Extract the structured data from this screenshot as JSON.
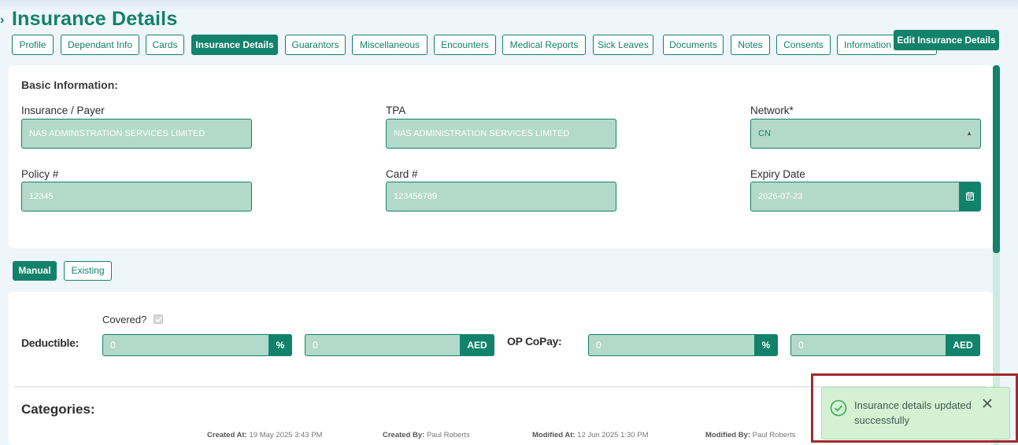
{
  "page": {
    "title": "Insurance Details"
  },
  "tabs": [
    {
      "label": "Profile"
    },
    {
      "label": "Dependant Info"
    },
    {
      "label": "Cards"
    },
    {
      "label": "Insurance Details",
      "active": true
    },
    {
      "label": "Guarantors"
    },
    {
      "label": "Miscellaneous"
    },
    {
      "label": "Encounters"
    },
    {
      "label": "Medical Reports"
    },
    {
      "label": "Sick Leaves"
    },
    {
      "label": "Documents"
    },
    {
      "label": "Notes"
    },
    {
      "label": "Consents"
    },
    {
      "label": "Information"
    }
  ],
  "actions": {
    "edit_label": "Edit Insurance Details"
  },
  "basic_info": {
    "title": "Basic Information:",
    "insurance_label": "Insurance / Payer",
    "insurance_value": "NAS ADMINISTRATION SERVICES LIMITED",
    "tpa_label": "TPA",
    "tpa_value": "NAS ADMINISTRATION SERVICES LIMITED",
    "network_label": "Network*",
    "network_value": "CN",
    "policy_label": "Policy #",
    "policy_value": "12345",
    "card_label": "Card #",
    "card_value": "123456789",
    "expiry_label": "Expiry Date",
    "expiry_value": "2026-07-23"
  },
  "mode": {
    "manual_label": "Manual",
    "existing_label": "Existing"
  },
  "coverage": {
    "covered_label": "Covered?",
    "covered_checked": true,
    "deductible_label": "Deductible:",
    "deductible_percent": "0",
    "deductible_amount": "0",
    "opcopay_label": "OP CoPay:",
    "opcopay_percent": "0",
    "opcopay_amount": "0",
    "percent_symbol": "%",
    "currency": "AED"
  },
  "categories": {
    "title": "Categories:"
  },
  "audit": {
    "created_at_label": "Created At:",
    "created_at": "19 May 2025 3:43 PM",
    "created_by_label": "Created By:",
    "created_by": "Paul Roberts",
    "modified_at_label": "Modified At:",
    "modified_at": "12 Jun 2025 1:30 PM",
    "modified_by_label": "Modified By:",
    "modified_by": "Paul Roberts"
  },
  "toast": {
    "message": "Insurance details updated successfully"
  },
  "colors": {
    "accent": "#12826a",
    "field_bg": "#b3d9ca",
    "toast_bg": "#d5f1d4",
    "highlight": "#a32a2a"
  }
}
